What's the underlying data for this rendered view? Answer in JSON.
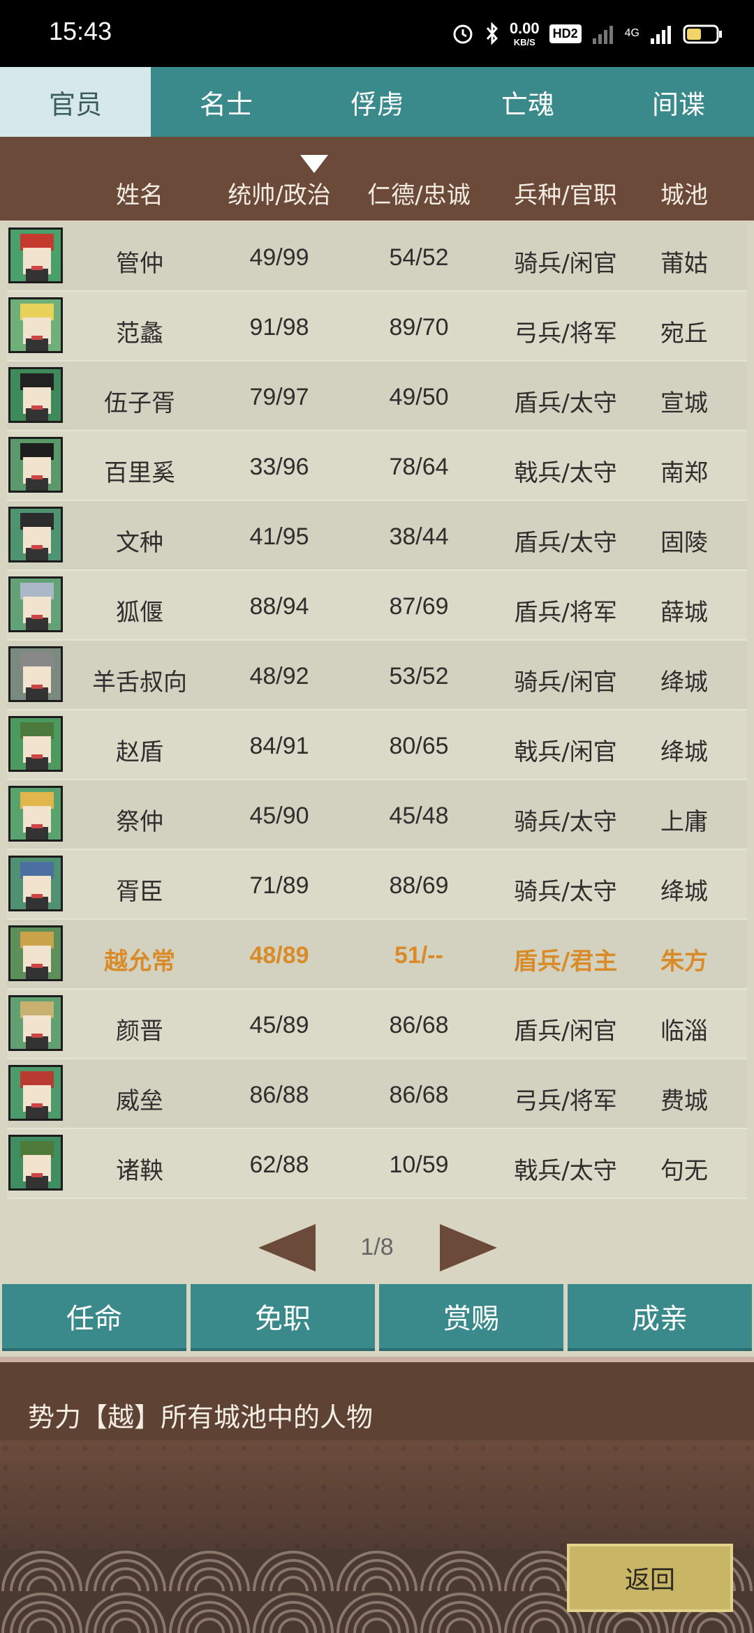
{
  "status_bar": {
    "time": "15:43",
    "speed_value": "0.00",
    "speed_unit": "KB/S",
    "hd_badge": "HD2",
    "network_label": "4G"
  },
  "tabs": [
    {
      "label": "官员",
      "active": true
    },
    {
      "label": "名士",
      "active": false
    },
    {
      "label": "俘虏",
      "active": false
    },
    {
      "label": "亡魂",
      "active": false
    },
    {
      "label": "间谍",
      "active": false
    }
  ],
  "table": {
    "headers": [
      "姓名",
      "统帅/政治",
      "仁德/忠诚",
      "兵种/官职",
      "城池"
    ],
    "rows": [
      {
        "name": "管仲",
        "lead_pol": "49/99",
        "virtue_loyal": "54/52",
        "troop_title": "骑兵/闲官",
        "city": "莆姑"
      },
      {
        "name": "范蠡",
        "lead_pol": "91/98",
        "virtue_loyal": "89/70",
        "troop_title": "弓兵/将军",
        "city": "宛丘"
      },
      {
        "name": "伍子胥",
        "lead_pol": "79/97",
        "virtue_loyal": "49/50",
        "troop_title": "盾兵/太守",
        "city": "宣城"
      },
      {
        "name": "百里奚",
        "lead_pol": "33/96",
        "virtue_loyal": "78/64",
        "troop_title": "戟兵/太守",
        "city": "南郑"
      },
      {
        "name": "文种",
        "lead_pol": "41/95",
        "virtue_loyal": "38/44",
        "troop_title": "盾兵/太守",
        "city": "固陵"
      },
      {
        "name": "狐偃",
        "lead_pol": "88/94",
        "virtue_loyal": "87/69",
        "troop_title": "盾兵/将军",
        "city": "薛城"
      },
      {
        "name": "羊舌叔向",
        "lead_pol": "48/92",
        "virtue_loyal": "53/52",
        "troop_title": "骑兵/闲官",
        "city": "绛城"
      },
      {
        "name": "赵盾",
        "lead_pol": "84/91",
        "virtue_loyal": "80/65",
        "troop_title": "戟兵/闲官",
        "city": "绛城"
      },
      {
        "name": "祭仲",
        "lead_pol": "45/90",
        "virtue_loyal": "45/48",
        "troop_title": "骑兵/太守",
        "city": "上庸"
      },
      {
        "name": "胥臣",
        "lead_pol": "71/89",
        "virtue_loyal": "88/69",
        "troop_title": "骑兵/太守",
        "city": "绛城"
      },
      {
        "name": "越允常",
        "lead_pol": "48/89",
        "virtue_loyal": "51/--",
        "troop_title": "盾兵/君主",
        "city": "朱方",
        "highlight": true
      },
      {
        "name": "颜晋",
        "lead_pol": "45/89",
        "virtue_loyal": "86/68",
        "troop_title": "盾兵/闲官",
        "city": "临淄"
      },
      {
        "name": "威垒",
        "lead_pol": "86/88",
        "virtue_loyal": "86/68",
        "troop_title": "弓兵/将军",
        "city": "费城"
      },
      {
        "name": "诸鞅",
        "lead_pol": "62/88",
        "virtue_loyal": "10/59",
        "troop_title": "戟兵/太守",
        "city": "句无"
      }
    ]
  },
  "pager": {
    "label": "1/8"
  },
  "actions": [
    "任命",
    "免职",
    "赏赐",
    "成亲"
  ],
  "info_text": "势力【越】所有城池中的人物",
  "back_label": "返回",
  "colors": {
    "teal": "#3a8a8c",
    "brown": "#6b4a3a",
    "highlight": "#d98b2a",
    "back_button": "#c8b566"
  }
}
